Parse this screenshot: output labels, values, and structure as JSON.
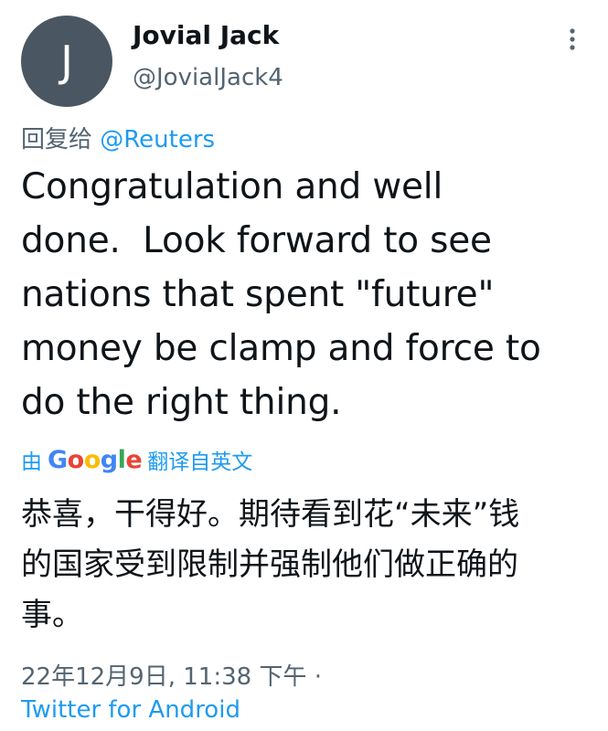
{
  "author": {
    "avatar_letter": "J",
    "avatar_color": "#4a5662",
    "display_name": "Jovial Jack",
    "handle": "@JovialJack4"
  },
  "reply": {
    "prefix": "回复给",
    "mention": "@Reuters"
  },
  "tweet": {
    "text": "Congratulation and well\ndone.  Look forward to see\nnations that spent \"future\"\nmoney be clamp and force to\ndo the right thing."
  },
  "translation": {
    "prefix": "由",
    "provider_letters": [
      "G",
      "o",
      "o",
      "g",
      "l",
      "e"
    ],
    "suffix": "翻译自英文",
    "text": "恭喜，干得好。期待看到花“未来”钱\n的国家受到限制并强制他们做正确的\n事。"
  },
  "meta": {
    "timestamp": "22年12月9日, 11:38 下午 ·",
    "source": "Twitter for Android"
  },
  "icons": {
    "more": "more-vertical-icon"
  },
  "colors": {
    "link": "#1d9bf0",
    "secondary_text": "#536471",
    "primary_text": "#0f1419"
  }
}
